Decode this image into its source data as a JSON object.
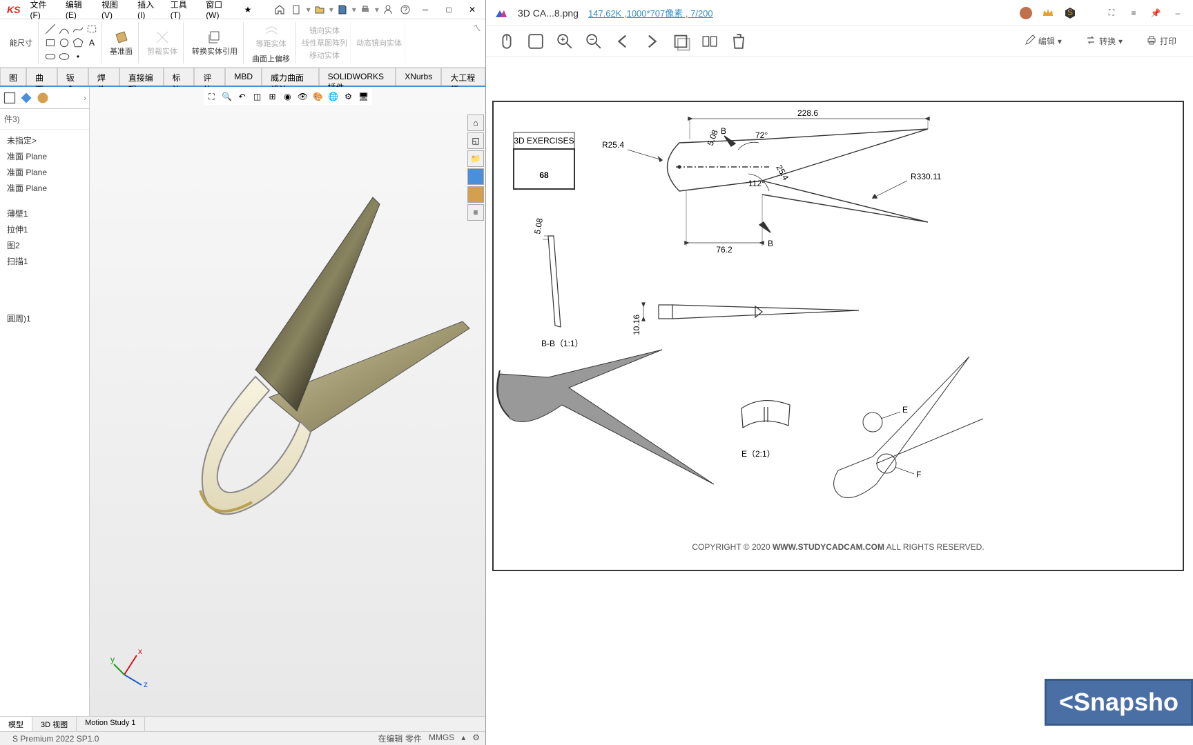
{
  "solidworks": {
    "logo_text": "KS",
    "menu": {
      "file": "文件(F)",
      "edit": "编辑(E)",
      "view": "视图(V)",
      "insert": "插入(I)",
      "tools": "工具(T)",
      "window": "窗口(W)"
    },
    "ribbon": {
      "dimension": "能尺寸",
      "datum_plane": "基准面",
      "trim_body": "剪裁实体",
      "convert_ref": "转换实体引用",
      "equidistant": "等距实体",
      "offset_surface": "曲面上偏移",
      "mirror_body": "镜向实体",
      "linear_pattern": "线性草图阵列",
      "move_body": "移动实体",
      "dynamic_mirror": "动态镜向实体"
    },
    "tabs": [
      "图",
      "曲面",
      "钣金",
      "焊件",
      "直接编辑",
      "标注",
      "评估",
      "MBD",
      "威力曲面设计",
      "SOLIDWORKS 插件",
      "XNurbs",
      "大工程师"
    ],
    "tree_header": "件3)",
    "tree_items": [
      "未指定>",
      "准面 Plane",
      "准面 Plane",
      "准面 Plane",
      "",
      "薄壁1",
      "拉伸1",
      "图2",
      "扫描1",
      "",
      "圆周)1"
    ],
    "bottom_tabs": [
      "模型",
      "3D 视图",
      "Motion Study 1"
    ],
    "status": {
      "version": "S Premium 2022 SP1.0",
      "mode": "在编辑 零件",
      "units": "MMGS"
    }
  },
  "imageviewer": {
    "filename": "3D CA...8.png",
    "fileinfo": "147.62K ,1000*707像素 , 7/200",
    "actions": {
      "edit": "编辑",
      "convert": "转换",
      "print": "打印"
    }
  },
  "drawing": {
    "exercise_label": "3D EXERCISES",
    "exercise_number": "68",
    "section_bb": "B-B（1:1）",
    "detail_e": "E（2:1）",
    "dims": {
      "len_top": "228.6",
      "r_left": "R25.4",
      "r_right": "R330.11",
      "angle_top": "72°",
      "angle_mid": "112°",
      "thick1": "5.08",
      "thick2": "25.4",
      "len_bottom": "76.2",
      "sec_b1": "B",
      "sec_b2": "B",
      "bb_thick": "5.08",
      "side_h": "10.16",
      "call_e": "E",
      "call_f": "F"
    },
    "copyright_pre": "COPYRIGHT © 2020 ",
    "copyright_site": "WWW.STUDYCADCAM.COM",
    "copyright_post": " ALL RIGHTS RESERVED."
  },
  "watermark": "<Snapsho"
}
